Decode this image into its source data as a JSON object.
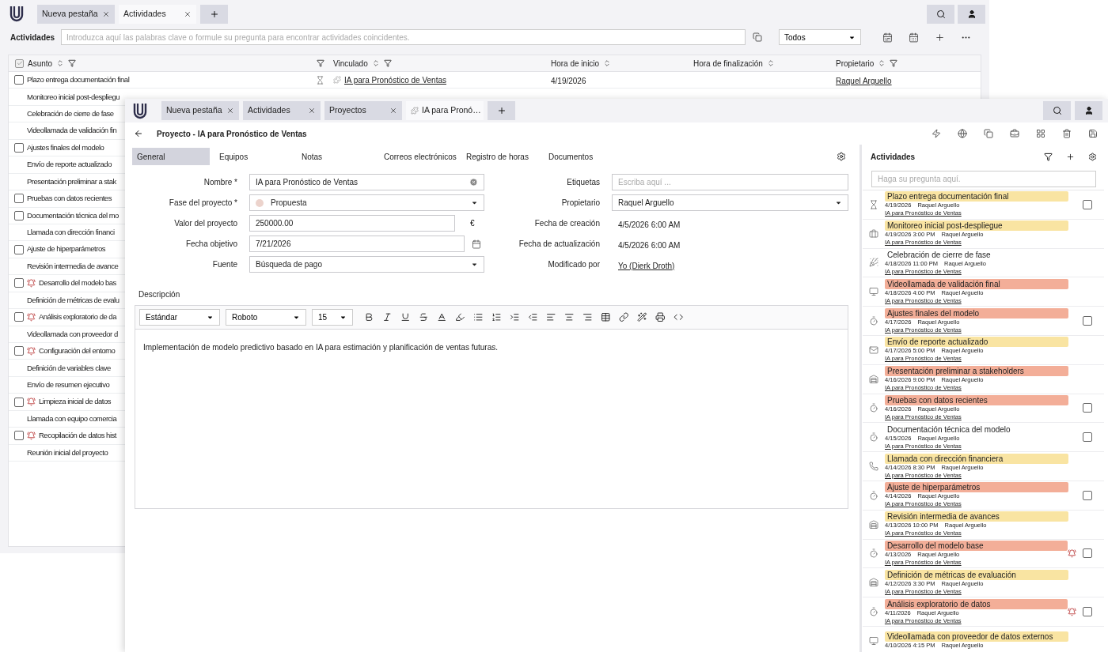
{
  "back_window": {
    "tabs": [
      {
        "label": "Nueva pestaña",
        "selected": false
      },
      {
        "label": "Actividades",
        "selected": true
      }
    ],
    "toolbar": {
      "title": "Actividades",
      "search_placeholder": "Introduzca aquí las palabras clave o formule su pregunta para encontrar actividades coincidentes.",
      "filter": "Todos"
    },
    "table": {
      "select_all_checked": true,
      "columns": [
        {
          "label": "Asunto",
          "sortable": true,
          "filterable": true
        },
        {
          "filterable": true
        },
        {
          "label": "Vinculado",
          "sortable": true,
          "filterable": true
        },
        {
          "label": "Hora de inicio",
          "sortable": true,
          "filterable": false
        },
        {
          "label": "Hora de finalización",
          "sortable": true,
          "filterable": false
        },
        {
          "label": "Propietario",
          "sortable": true,
          "filterable": true
        }
      ],
      "rows": [
        {
          "subject": "Plazo entrega documentación final",
          "checked": false,
          "alarm": false,
          "kind": "deadline",
          "linked": "IA para Pronóstico de Ventas",
          "start": "4/19/2026",
          "owner": "Raquel Arguello"
        },
        {
          "subject": "Monitoreo inicial post-despliegu",
          "alarm": false
        },
        {
          "subject": "Celebración de cierre de fase",
          "alarm": false
        },
        {
          "subject": "Videollamada de validación fin",
          "alarm": false
        },
        {
          "subject": "Ajustes finales del modelo",
          "checked": false,
          "alarm": false
        },
        {
          "subject": "Envío de reporte actualizado",
          "alarm": false
        },
        {
          "subject": "Presentación preliminar a stak",
          "alarm": false
        },
        {
          "subject": "Pruebas con datos recientes",
          "checked": false,
          "alarm": false
        },
        {
          "subject": "Documentación técnica del mo",
          "checked": false,
          "alarm": false
        },
        {
          "subject": "Llamada con dirección financi",
          "alarm": false
        },
        {
          "subject": "Ajuste de hiperparámetros",
          "checked": false,
          "alarm": false
        },
        {
          "subject": "Revisión intermedia de avance",
          "alarm": false
        },
        {
          "subject": "Desarrollo del modelo bas",
          "checked": false,
          "alarm": true
        },
        {
          "subject": "Definición de métricas de evalu",
          "alarm": false
        },
        {
          "subject": "Análisis exploratorio de da",
          "checked": false,
          "alarm": true
        },
        {
          "subject": "Videollamada con proveedor d",
          "alarm": false
        },
        {
          "subject": "Configuración del entorno",
          "checked": false,
          "alarm": true
        },
        {
          "subject": "Definición de variables clave",
          "alarm": false
        },
        {
          "subject": "Envío de resumen ejecutivo",
          "alarm": false
        },
        {
          "subject": "Limpieza inicial de datos",
          "checked": false,
          "alarm": true
        },
        {
          "subject": "Llamada con equipo comercia",
          "alarm": false
        },
        {
          "subject": "Recopilación de datos hist",
          "checked": false,
          "alarm": true
        },
        {
          "subject": "Reunión inicial del proyecto",
          "alarm": false
        }
      ]
    }
  },
  "front_window": {
    "tabs": [
      {
        "label": "Nueva pestaña",
        "selected": false
      },
      {
        "label": "Actividades",
        "selected": false
      },
      {
        "label": "Proyectos",
        "selected": false
      },
      {
        "label": "IA para Pronó…",
        "selected": true
      }
    ],
    "title": "Proyecto - IA para Pronóstico de Ventas",
    "section_tabs": [
      {
        "label": "General",
        "selected": true
      },
      {
        "label": "Equipos",
        "selected": false
      },
      {
        "label": "Notas",
        "selected": false
      },
      {
        "label": "Correos electrónicos",
        "selected": false
      },
      {
        "label": "Registro de horas",
        "selected": false
      },
      {
        "label": "Documentos",
        "selected": false
      }
    ],
    "left_fields": [
      {
        "label": "Nombre *",
        "kind": "text",
        "value": "IA para Pronóstico de Ventas"
      },
      {
        "label": "Fase del proyecto *",
        "kind": "select",
        "value": "Propuesta",
        "color": "#ecd3cc"
      },
      {
        "label": "Valor del proyecto",
        "kind": "money",
        "value": "250000.00",
        "suffix": "€"
      },
      {
        "label": "Fecha objetivo",
        "kind": "date",
        "value": "7/21/2026"
      },
      {
        "label": "Fuente",
        "kind": "select",
        "value": "Búsqueda de pago"
      }
    ],
    "right_fields": [
      {
        "label": "Etiquetas",
        "kind": "text",
        "placeholder": "Escriba aquí ..."
      },
      {
        "label": "Propietario",
        "kind": "select",
        "value": "Raquel Arguello"
      },
      {
        "label": "Fecha de creación",
        "kind": "static",
        "value": "4/5/2026 6:00 AM"
      },
      {
        "label": "Fecha de actualización",
        "kind": "static",
        "value": "4/5/2026 6:00 AM"
      },
      {
        "label": "Modificado por",
        "kind": "link",
        "value": "Yo (Dierk Droth)"
      }
    ],
    "description": {
      "label": "Descripción",
      "style": "Estándar",
      "font": "Roboto",
      "size": "15",
      "text": "Implementación de modelo predictivo basado en IA para estimación y planificación de ventas futuras."
    },
    "activities": {
      "title": "Actividades",
      "search_placeholder": "Haga su pregunta aquí.",
      "items": [
        {
          "kind": "deadline",
          "title": "Plazo entrega documentación final",
          "color": "#f9e4a2",
          "date": "4/19/2026",
          "owner": "Raquel Arguello",
          "link": "IA para Pronóstico de Ventas",
          "checked": false,
          "alarm": false
        },
        {
          "kind": "milestone",
          "title": "Monitoreo inicial post-despliegue",
          "color": "#f9e4a2",
          "date": "4/19/2026 3:00 PM",
          "owner": "Raquel Arguello",
          "link": "IA para Pronóstico de Ventas",
          "alarm": false
        },
        {
          "kind": "celebration",
          "title": "Celebración de cierre de fase",
          "date": "4/18/2026 11:00 PM",
          "owner": "Raquel Arguello",
          "link": "IA para Pronóstico de Ventas",
          "alarm": false
        },
        {
          "kind": "video_call",
          "title": "Videollamada de validación final",
          "color": "#f3ae98",
          "date": "4/18/2026 4:00 PM",
          "owner": "Raquel Arguello",
          "link": "IA para Pronóstico de Ventas",
          "alarm": false
        },
        {
          "kind": "task",
          "title": "Ajustes finales del modelo",
          "color": "#f3ae98",
          "date": "4/17/2026",
          "owner": "Raquel Arguello",
          "link": "IA para Pronóstico de Ventas",
          "checked": false,
          "alarm": false
        },
        {
          "kind": "email",
          "title": "Envío de reporte actualizado",
          "color": "#f9e4a2",
          "date": "4/17/2026 5:00 PM",
          "owner": "Raquel Arguello",
          "link": "IA para Pronóstico de Ventas",
          "alarm": false
        },
        {
          "kind": "meeting",
          "title": "Presentación preliminar a stakeholders",
          "color": "#f3ae98",
          "date": "4/16/2026 9:00 PM",
          "owner": "Raquel Arguello",
          "link": "IA para Pronóstico de Ventas",
          "alarm": false
        },
        {
          "kind": "task",
          "title": "Pruebas con datos recientes",
          "color": "#f3ae98",
          "date": "4/16/2026",
          "owner": "Raquel Arguello",
          "link": "IA para Pronóstico de Ventas",
          "checked": false,
          "alarm": false
        },
        {
          "kind": "task",
          "title": "Documentación técnica del modelo",
          "date": "4/15/2026",
          "owner": "Raquel Arguello",
          "link": "IA para Pronóstico de Ventas",
          "checked": false,
          "alarm": false
        },
        {
          "kind": "call",
          "title": "Llamada con dirección financiera",
          "color": "#f9e4a2",
          "date": "4/14/2026 8:30 PM",
          "owner": "Raquel Arguello",
          "link": "IA para Pronóstico de Ventas",
          "alarm": false
        },
        {
          "kind": "task",
          "title": "Ajuste de hiperparámetros",
          "color": "#f3ae98",
          "date": "4/14/2026",
          "owner": "Raquel Arguello",
          "link": "IA para Pronóstico de Ventas",
          "checked": false,
          "alarm": false
        },
        {
          "kind": "meeting",
          "title": "Revisión intermedia de avances",
          "color": "#f9e4a2",
          "date": "4/13/2026 10:00 PM",
          "owner": "Raquel Arguello",
          "link": "IA para Pronóstico de Ventas",
          "alarm": false
        },
        {
          "kind": "task",
          "title": "Desarrollo del modelo base",
          "color": "#f3ae98",
          "date": "4/13/2026",
          "owner": "Raquel Arguello",
          "link": "IA para Pronóstico de Ventas",
          "checked": false,
          "alarm": true
        },
        {
          "kind": "meeting",
          "title": "Definición de métricas de evaluación",
          "color": "#f9e4a2",
          "date": "4/12/2026 3:30 PM",
          "owner": "Raquel Arguello",
          "link": "IA para Pronóstico de Ventas",
          "alarm": false
        },
        {
          "kind": "task",
          "title": "Análisis exploratorio de datos",
          "color": "#f3ae98",
          "date": "4/11/2026",
          "owner": "Raquel Arguello",
          "link": "IA para Pronóstico de Ventas",
          "checked": false,
          "alarm": true
        },
        {
          "kind": "video_call",
          "title": "Videollamada con proveedor de datos externos",
          "color": "#f9e4a2",
          "date": "4/10/2026 4:15 PM",
          "owner": "Raquel Arguello",
          "alarm": false
        }
      ]
    }
  }
}
